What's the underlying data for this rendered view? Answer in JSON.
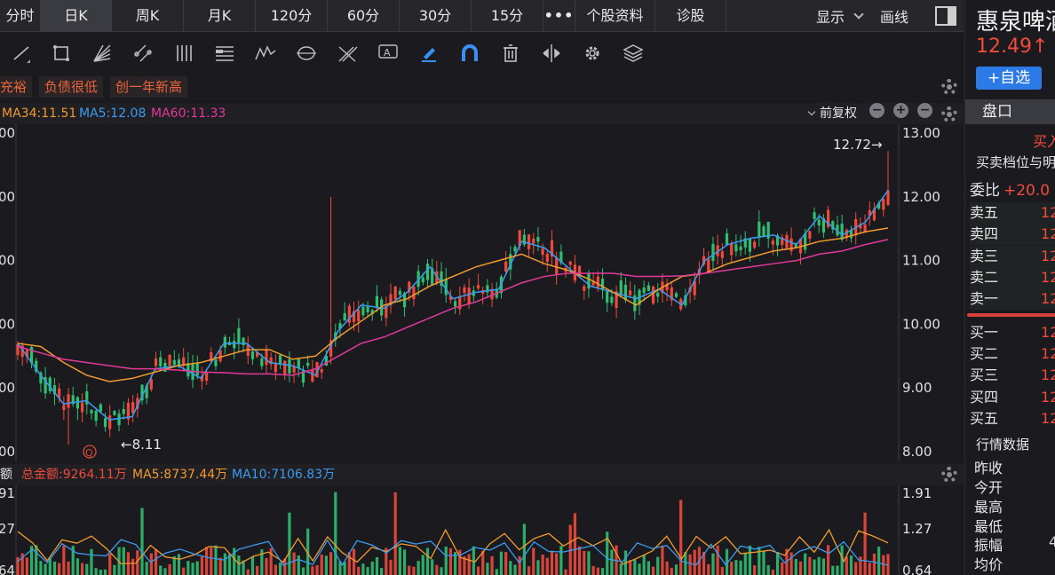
{
  "tabs": [
    {
      "label": "分时",
      "active": false
    },
    {
      "label": "日K",
      "active": true
    },
    {
      "label": "周K",
      "active": false
    },
    {
      "label": "月K",
      "active": false
    },
    {
      "label": "120分",
      "active": false
    },
    {
      "label": "60分",
      "active": false
    },
    {
      "label": "30分",
      "active": false
    },
    {
      "label": "15分",
      "active": false
    }
  ],
  "tab_more": "•••",
  "tab_links": [
    "个股资料",
    "诊股"
  ],
  "tab_right": {
    "display": "显示",
    "draw": "画线"
  },
  "tags": [
    "充裕",
    "负债很低",
    "创一年新高"
  ],
  "legend": {
    "ma34": "MA34:11.51",
    "ma5": "MA5:12.08",
    "ma60": "MA60:11.33",
    "adjust": "前复权",
    "minus": "−",
    "plus": "+"
  },
  "volume_legend": {
    "label": "额",
    "total": "总金额:9264.11万",
    "ma5": "MA5:8737.44万",
    "ma10": "MA10:7106.83万"
  },
  "price_axis": {
    "right_ticks": [
      "13.00",
      "12.00",
      "11.00",
      "10.00",
      "9.00",
      "8.00"
    ],
    "left_ticks": [
      "00",
      "00",
      "00",
      "00",
      "00",
      "00"
    ]
  },
  "volume_axis": {
    "right_ticks": [
      "1.91",
      "1.27",
      "0.64"
    ],
    "left_ticks": [
      "91",
      "27",
      "64"
    ]
  },
  "annotations": {
    "high": "12.72→",
    "low": "←8.11",
    "q_marker": "Q"
  },
  "colors": {
    "up": "#f0493c",
    "down": "#2fbf71",
    "ma5": "#3b9bf0",
    "ma34": "#f29a2e",
    "ma60": "#e0399a",
    "tag": "#e9643c"
  },
  "chart_data": {
    "type": "candlestick",
    "title": "",
    "series": [
      {
        "name": "MA5",
        "values": [
          9.7,
          9.2,
          8.75,
          8.8,
          8.5,
          8.55,
          9.3,
          9.35,
          9.15,
          9.7,
          9.7,
          9.4,
          9.35,
          9.2,
          9.9,
          10.3,
          10.25,
          10.5,
          10.9,
          10.4,
          10.5,
          10.55,
          11.3,
          11.2,
          10.9,
          10.6,
          10.5,
          10.4,
          10.55,
          10.3,
          11.0,
          11.25,
          11.35,
          11.4,
          11.25,
          11.7,
          11.4,
          11.6,
          12.1
        ]
      },
      {
        "name": "MA34",
        "values": [
          9.7,
          9.65,
          9.4,
          9.2,
          9.1,
          9.15,
          9.25,
          9.35,
          9.4,
          9.5,
          9.6,
          9.6,
          9.45,
          9.5,
          9.8,
          10.05,
          10.3,
          10.4,
          10.6,
          10.75,
          10.9,
          11.0,
          11.1,
          10.95,
          10.85,
          10.7,
          10.5,
          10.3,
          10.55,
          10.75,
          10.8,
          10.95,
          11.05,
          11.15,
          11.2,
          11.3,
          11.35,
          11.45,
          11.51
        ]
      },
      {
        "name": "MA60",
        "values": [
          9.65,
          9.55,
          9.45,
          9.4,
          9.35,
          9.3,
          9.3,
          9.28,
          9.25,
          9.24,
          9.22,
          9.22,
          9.2,
          9.3,
          9.5,
          9.7,
          9.8,
          9.95,
          10.1,
          10.25,
          10.35,
          10.5,
          10.65,
          10.75,
          10.8,
          10.8,
          10.8,
          10.75,
          10.75,
          10.76,
          10.8,
          10.85,
          10.9,
          10.95,
          11.0,
          11.1,
          11.15,
          11.25,
          11.33
        ]
      }
    ],
    "high": 12.72,
    "low": 8.11,
    "y_ticks": [
      13.0,
      12.0,
      11.0,
      10.0,
      9.0,
      8.0
    ],
    "volume_y_ticks": [
      1.91,
      1.27,
      0.64
    ],
    "ylim": [
      8.0,
      13.0
    ]
  },
  "right_panel": {
    "name": "惠泉啤酒",
    "price": "12.49↑ +",
    "fav": "+自选",
    "tab": "盘口",
    "buy_head": "买入",
    "section_orderbook": "买卖档位与明细",
    "weibi_label": "委比",
    "weibi_value": "+20.0",
    "sells": [
      {
        "label": "卖五",
        "value": "12"
      },
      {
        "label": "卖四",
        "value": "12"
      },
      {
        "label": "卖三",
        "value": "12"
      },
      {
        "label": "卖二",
        "value": "12"
      },
      {
        "label": "卖一",
        "value": "12"
      }
    ],
    "buys": [
      {
        "label": "买一",
        "value": "12"
      },
      {
        "label": "买二",
        "value": "12"
      },
      {
        "label": "买三",
        "value": "12"
      },
      {
        "label": "买四",
        "value": "12"
      },
      {
        "label": "买五",
        "value": "12"
      }
    ],
    "section_quotes": "行情数据",
    "quotes": [
      {
        "label": "昨收",
        "value": ""
      },
      {
        "label": "今开",
        "value": ""
      },
      {
        "label": "最高",
        "value": ""
      },
      {
        "label": "最低",
        "value": ""
      },
      {
        "label": "振幅",
        "value": "4"
      },
      {
        "label": "均价",
        "value": ""
      }
    ]
  }
}
